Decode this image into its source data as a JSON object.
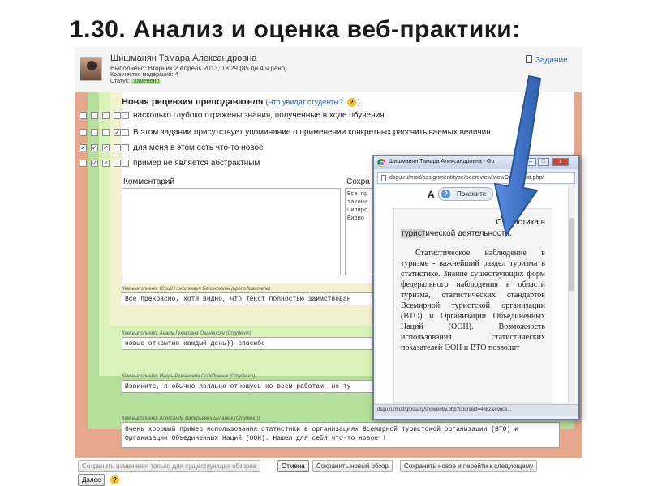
{
  "slide": {
    "title": "1.30. Анализ и оценка веб-практики:"
  },
  "submission": {
    "author": "Шишманян Тамара Александровна",
    "submitted": "Выполнено: Вторник 2 Апрель 2013, 18:29 (85 дн 4 ч рано)",
    "moderations": "Количество модераций: 4",
    "status_label": "Статус:",
    "status_value": "Заменено",
    "task_link": "Задание"
  },
  "review": {
    "title": "Новая рецензия преподавателя",
    "who_sees_prefix": "(",
    "who_sees": "Что увидят студенты?",
    "who_sees_suffix": ")",
    "help_glyph": "?",
    "criteria": [
      {
        "text": "насколько глубоко отражены знания, полученные в ходе обучения",
        "checks": [
          false,
          false,
          false,
          false
        ]
      },
      {
        "text": "В этом задании присутствует упоминание о применении конкретных рассчитываемых величин",
        "checks": [
          false,
          false,
          false,
          true
        ]
      },
      {
        "text": "для меня в этом есть что-то новое",
        "checks": [
          true,
          true,
          true,
          false
        ]
      },
      {
        "text": "пример не является абстрактным",
        "checks": [
          false,
          true,
          true,
          false
        ]
      }
    ],
    "comment_label": "Комментарий",
    "saved_label": "Сохра",
    "saved_text": "Все пр закони ципиро Видно"
  },
  "prior_reviews": [
    {
      "by": "Кем выполнено: Юрий Николаевич Белоножкин (преподаватель)",
      "text": "Все прекрасно, хотя видно, что текст полностью заимствован"
    },
    {
      "by": "Кем выполнено: Анаим Гукасовна Ованнисян (Студент)",
      "text": "новые открытия каждый день)) спасибо"
    },
    {
      "by": "Кем выполнено: Игорь Романович Солодовник (Студент)",
      "text": "Извините, я обычно лояльно отношусь ко всем работам, но ту"
    },
    {
      "by": "Кем выполнено: Александр Валерьевич Буланюк (Студент)",
      "text": "Очень хороший пример использования статистики в организациях Всемирной туристской организации (ВТО) и Организации Объединенных Наций (ООН). Нашел для себя что-то новое !"
    }
  ],
  "buttons": {
    "save_existing": "Сохранить изменения только для существующих обзоров",
    "cancel": "Отмена",
    "save_new": "Сохранить новый обзор",
    "save_new_next": "Сохранить новое и перейти к следующему",
    "next": "Далее",
    "help_glyph": "?"
  },
  "popup": {
    "window_title": "Шишманян Тамара Александровна - Go",
    "url": "dsgu.ru/mod/assignment/type/peereview/viewOnlineText.php/",
    "min_glyph": "–",
    "max_glyph": "□",
    "close_glyph": "x",
    "heading_letter": "А",
    "show_button": "Покажите",
    "doc_title_1": "Статистика в",
    "doc_title_hl": "турист",
    "doc_title_2": "ической деятельности.",
    "doc_text": "Статистическое наблюдение в туризме - важнейший раздел туризма в статистике. Знание существующих форм федерального наблюдения в области туризма, статистических стандартов Всемирной туристской организации (ВТО) и Организации Объединенных Наций (ООН). Возможность использования статистических показателей ООН и ВТО позволит",
    "status_url": "dsgu.ru/mod/glossary/showentry.php?courseid=4682&conce..."
  },
  "colors": {
    "band_orange": "#e5a88d",
    "band_green": "#b5df9a",
    "band_lightgreen": "#d8f2b8",
    "band_cream": "#f2f2cf",
    "arrow_blue": "#3b73c7",
    "status_green": "#b7e8a4"
  }
}
